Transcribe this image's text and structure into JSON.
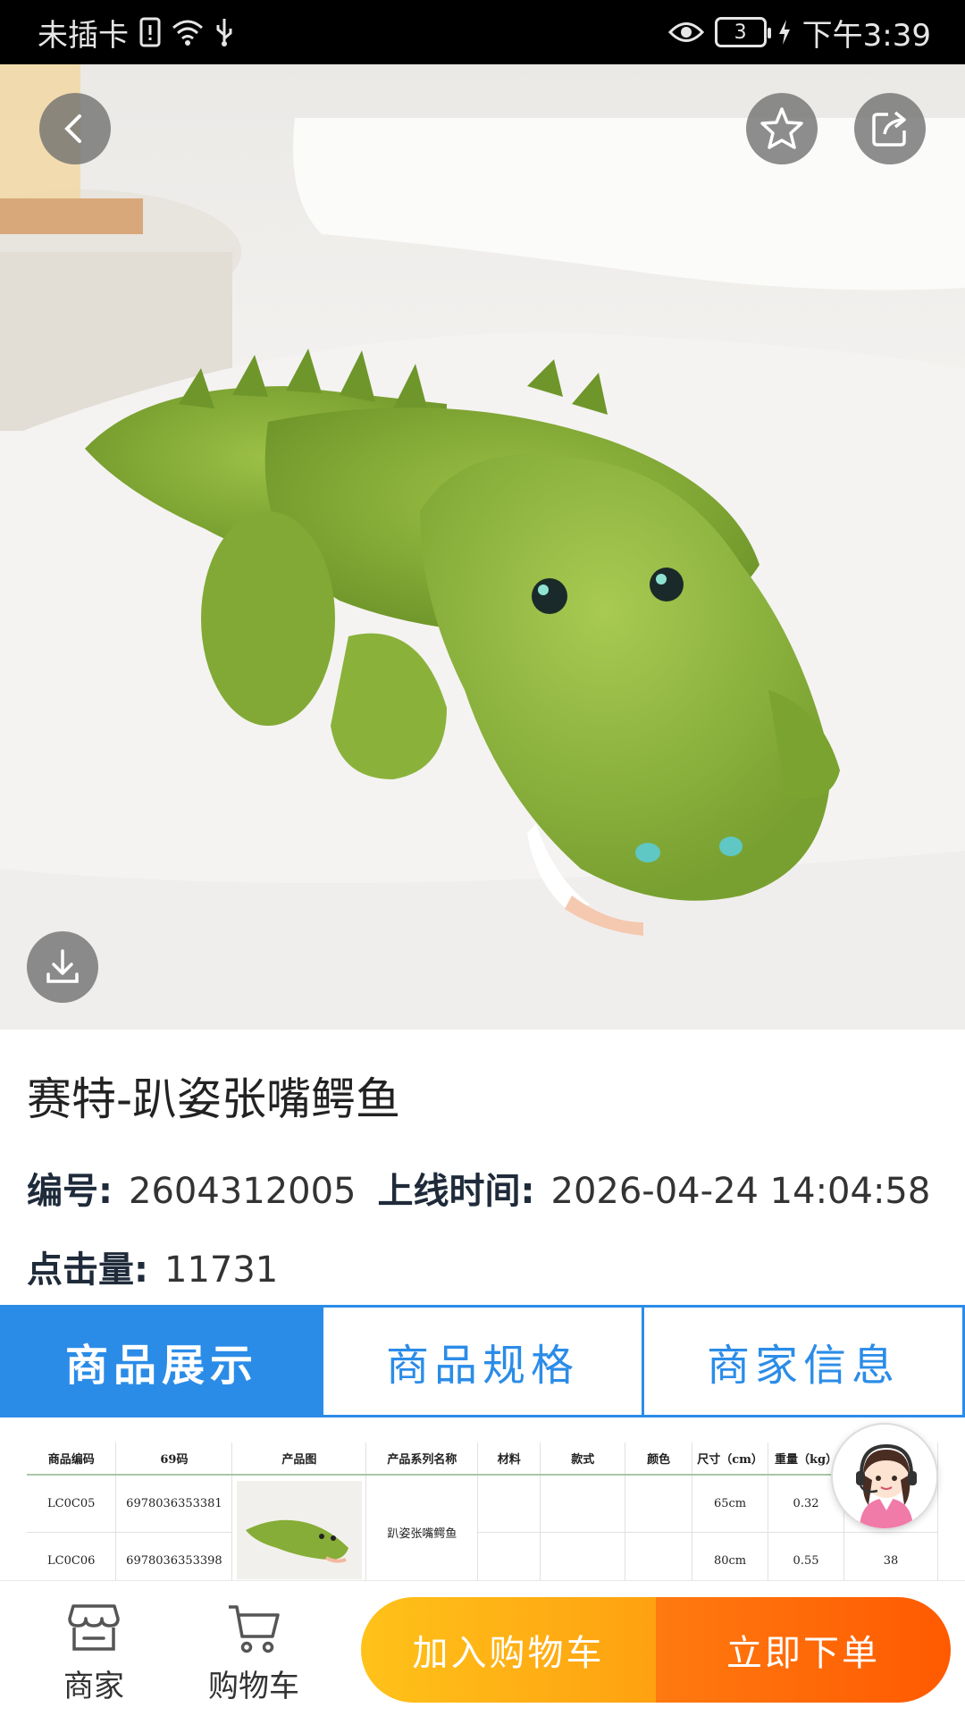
{
  "status_bar": {
    "carrier": "未插卡",
    "battery": "3",
    "time": "下午3:39"
  },
  "product": {
    "title": "赛特-趴姿张嘴鳄鱼",
    "id_label": "编号:",
    "id_value": "2604312005",
    "online_label": "上线时间:",
    "online_value": "2026-04-24 14:04:58",
    "clicks_label": "点击量:",
    "clicks_value": "11731"
  },
  "tabs": [
    {
      "label": "商品展示",
      "active": true
    },
    {
      "label": "商品规格",
      "active": false
    },
    {
      "label": "商家信息",
      "active": false
    }
  ],
  "spec_table": {
    "headers": [
      "商品编码",
      "69码",
      "产品图",
      "产品系列名称",
      "材料",
      "款式",
      "颜色",
      "尺寸（cm）",
      "重量（kg）",
      ""
    ],
    "rows": [
      {
        "code": "LC0C05",
        "barcode": "6978036353381",
        "series": "趴姿张嘴鳄鱼",
        "size": "65cm",
        "weight": "0.32",
        "qty": ""
      },
      {
        "code": "LC0C06",
        "barcode": "6978036353398",
        "series": "",
        "size": "80cm",
        "weight": "0.55",
        "qty": "38"
      }
    ]
  },
  "bottom_bar": {
    "merchant_label": "商家",
    "cart_label": "购物车",
    "add_to_cart": "加入购物车",
    "buy_now": "立即下单"
  },
  "colors": {
    "accent_blue": "#2b8ce8",
    "cart_yellow": "#ffb515",
    "buy_orange": "#ff6a08",
    "plush_green": "#8bb33a"
  }
}
